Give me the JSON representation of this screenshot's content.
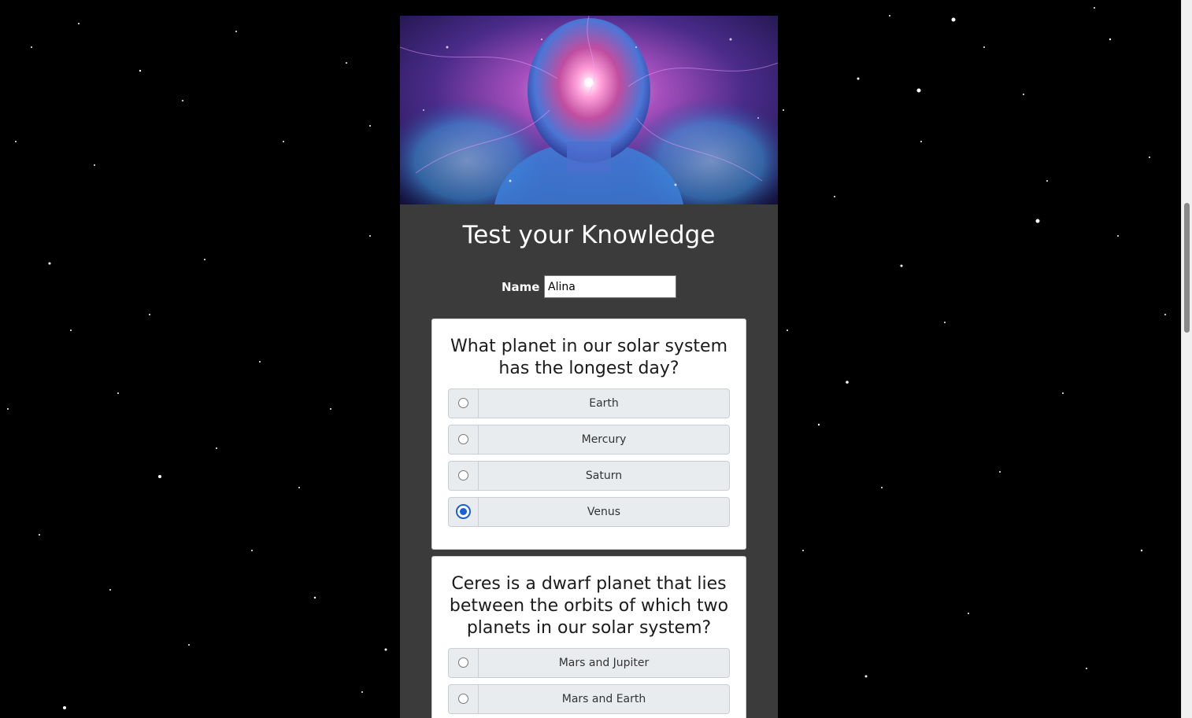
{
  "page": {
    "title": "Test your Knowledge",
    "name_label": "Name",
    "name_value": "Alina"
  },
  "hero_image": {
    "name": "cosmic-mind-image"
  },
  "questions": [
    {
      "text": "What planet in our solar system has the longest day?",
      "options": [
        {
          "label": "Earth",
          "selected": false
        },
        {
          "label": "Mercury",
          "selected": false
        },
        {
          "label": "Saturn",
          "selected": false
        },
        {
          "label": "Venus",
          "selected": true
        }
      ]
    },
    {
      "text": "Ceres is a dwarf planet that lies between the orbits of which two planets in our solar system?",
      "options": [
        {
          "label": "Mars and Jupiter",
          "selected": false
        },
        {
          "label": "Mars and Earth",
          "selected": false
        }
      ]
    }
  ],
  "colors": {
    "background": "#000000",
    "card": "#3b3b3b",
    "option_bg": "#e9ecef",
    "radio_checked": "#1a5fd6"
  }
}
